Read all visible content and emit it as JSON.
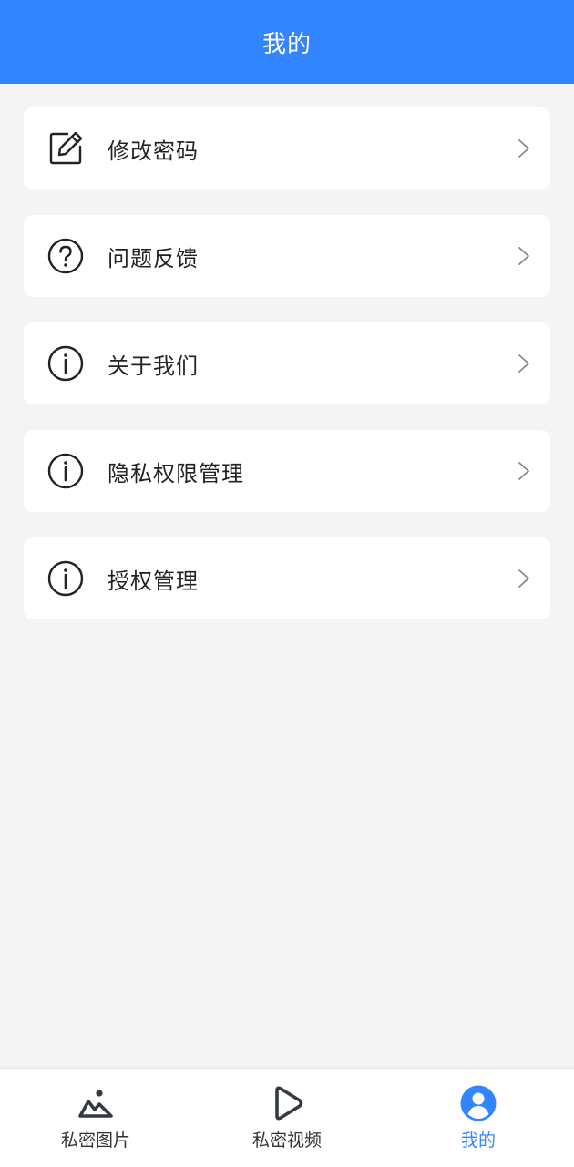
{
  "header": {
    "title": "我的"
  },
  "menu": {
    "items": [
      {
        "label": "修改密码",
        "icon": "edit-icon"
      },
      {
        "label": "问题反馈",
        "icon": "question-icon"
      },
      {
        "label": "关于我们",
        "icon": "info-icon"
      },
      {
        "label": "隐私权限管理",
        "icon": "info-icon"
      },
      {
        "label": "授权管理",
        "icon": "info-icon"
      }
    ]
  },
  "tabbar": {
    "items": [
      {
        "label": "私密图片",
        "icon": "picture-icon"
      },
      {
        "label": "私密视频",
        "icon": "play-icon"
      },
      {
        "label": "我的",
        "icon": "user-icon",
        "active": true
      }
    ]
  },
  "colors": {
    "accent": "#3385ff",
    "background": "#f4f4f4",
    "card": "#ffffff"
  }
}
